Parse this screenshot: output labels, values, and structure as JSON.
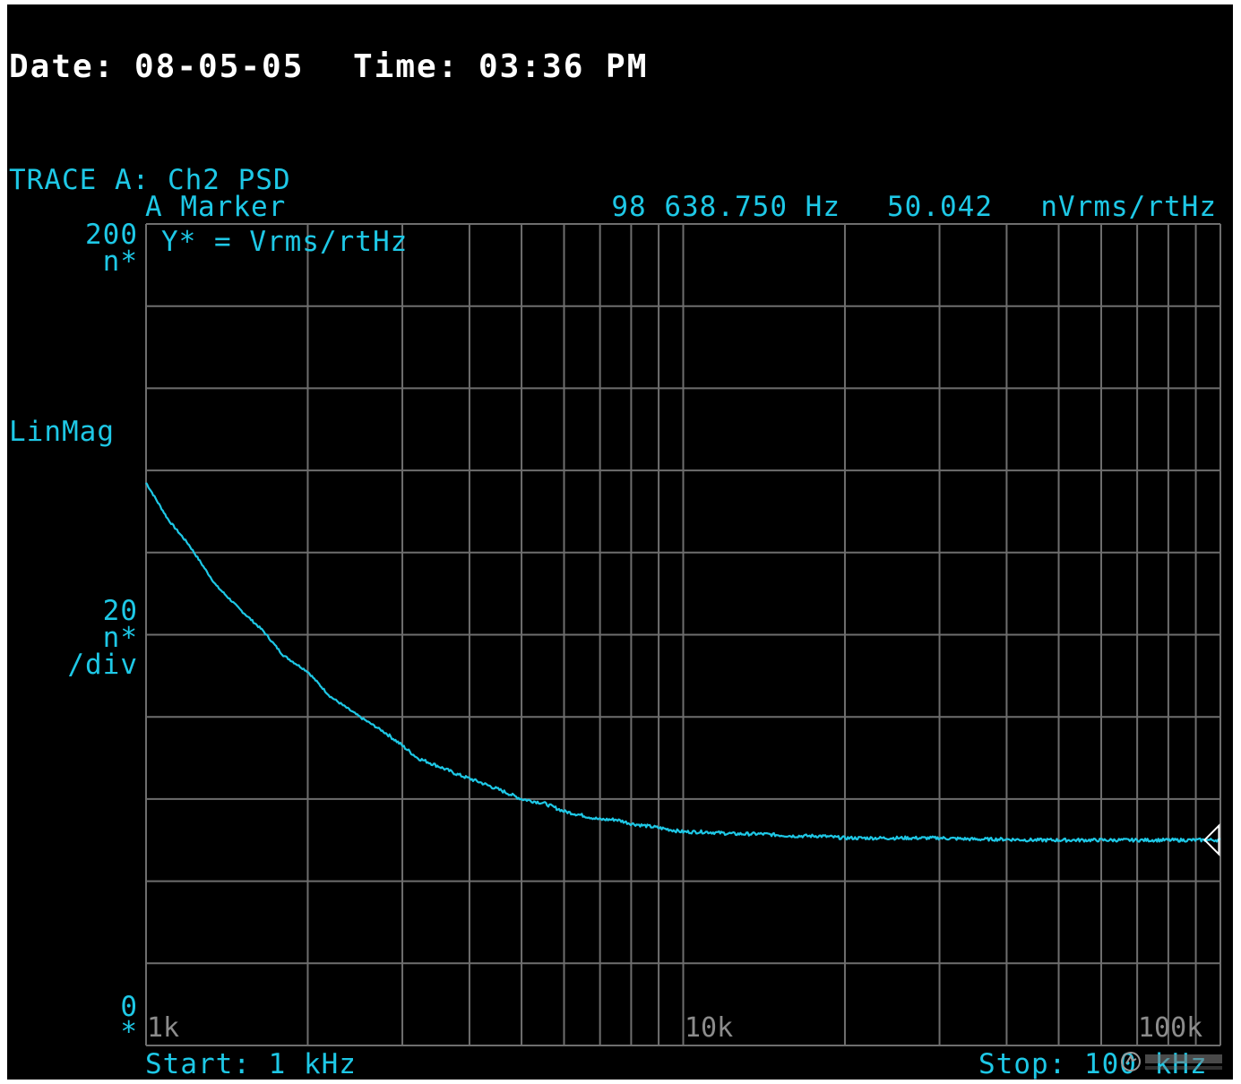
{
  "header": {
    "date_label": "Date:",
    "date_value": "08-05-05",
    "time_label": "Time:",
    "time_value": "03:36 PM"
  },
  "trace": {
    "title": "TRACE A: Ch2 PSD",
    "marker_label": "A Marker",
    "marker_freq": "98 638.750 Hz",
    "marker_value": "50.042",
    "marker_unit": "nVrms/rtHz",
    "y_def": "Y* = Vrms/rtHz"
  },
  "yaxis": {
    "top_value": "200",
    "top_unit": "n*",
    "mode": "LinMag",
    "div_value": "20",
    "div_unit": "n*",
    "div_suffix": "/div",
    "bottom_value": "0",
    "bottom_unit": "*"
  },
  "xaxis": {
    "tick_1k": "1k",
    "tick_10k": "10k",
    "tick_100k": "100k",
    "start": "Start: 1 kHz",
    "stop": "Stop: 100 kHz"
  },
  "watermark": {
    "text": "电子发烧友",
    "url": "www.elecfans.com"
  },
  "colors": {
    "background": "#000000",
    "trace": "#1ec8e6",
    "grid": "#6e6e6e",
    "header_text": "#ffffff",
    "tick_text": "#8c8c8c"
  },
  "chart_data": {
    "type": "line",
    "title": "TRACE A: Ch2 PSD",
    "xscale": "log",
    "xlim": [
      1000,
      100000
    ],
    "ylim": [
      0,
      200
    ],
    "xlabel": "",
    "ylabel": "LinMag",
    "x_ticks": [
      "1k",
      "10k",
      "100k"
    ],
    "y_unit": "nVrms/rtHz",
    "grid": true,
    "series": [
      {
        "x": [
          1000,
          1100,
          1200,
          1350,
          1500,
          1650,
          1800,
          2000,
          2200,
          2500,
          2800,
          3000,
          3200,
          3500,
          3800,
          4200,
          4600,
          5000,
          5500,
          6000,
          6500,
          7000,
          7500,
          8000,
          9000,
          10000,
          11000,
          12500,
          14000,
          16000,
          18000,
          20000,
          23000,
          26000,
          30000,
          35000,
          40000,
          45000,
          50000,
          55000,
          60000,
          70000,
          80000,
          90000,
          98639,
          100000
        ],
        "y": [
          137,
          128,
          122,
          112,
          106,
          101,
          95,
          91,
          85,
          80,
          76,
          73,
          70,
          68,
          66,
          64,
          62,
          60,
          59,
          57,
          56,
          55,
          55,
          54,
          53,
          52,
          52,
          51.5,
          51.5,
          51,
          51,
          50.5,
          50.5,
          50.5,
          50.5,
          50.2,
          50.2,
          50,
          50,
          50,
          50,
          50,
          50,
          50,
          50.04,
          50
        ]
      }
    ],
    "marker": {
      "x": 98638.75,
      "y": 50.042,
      "label": "A Marker"
    }
  }
}
